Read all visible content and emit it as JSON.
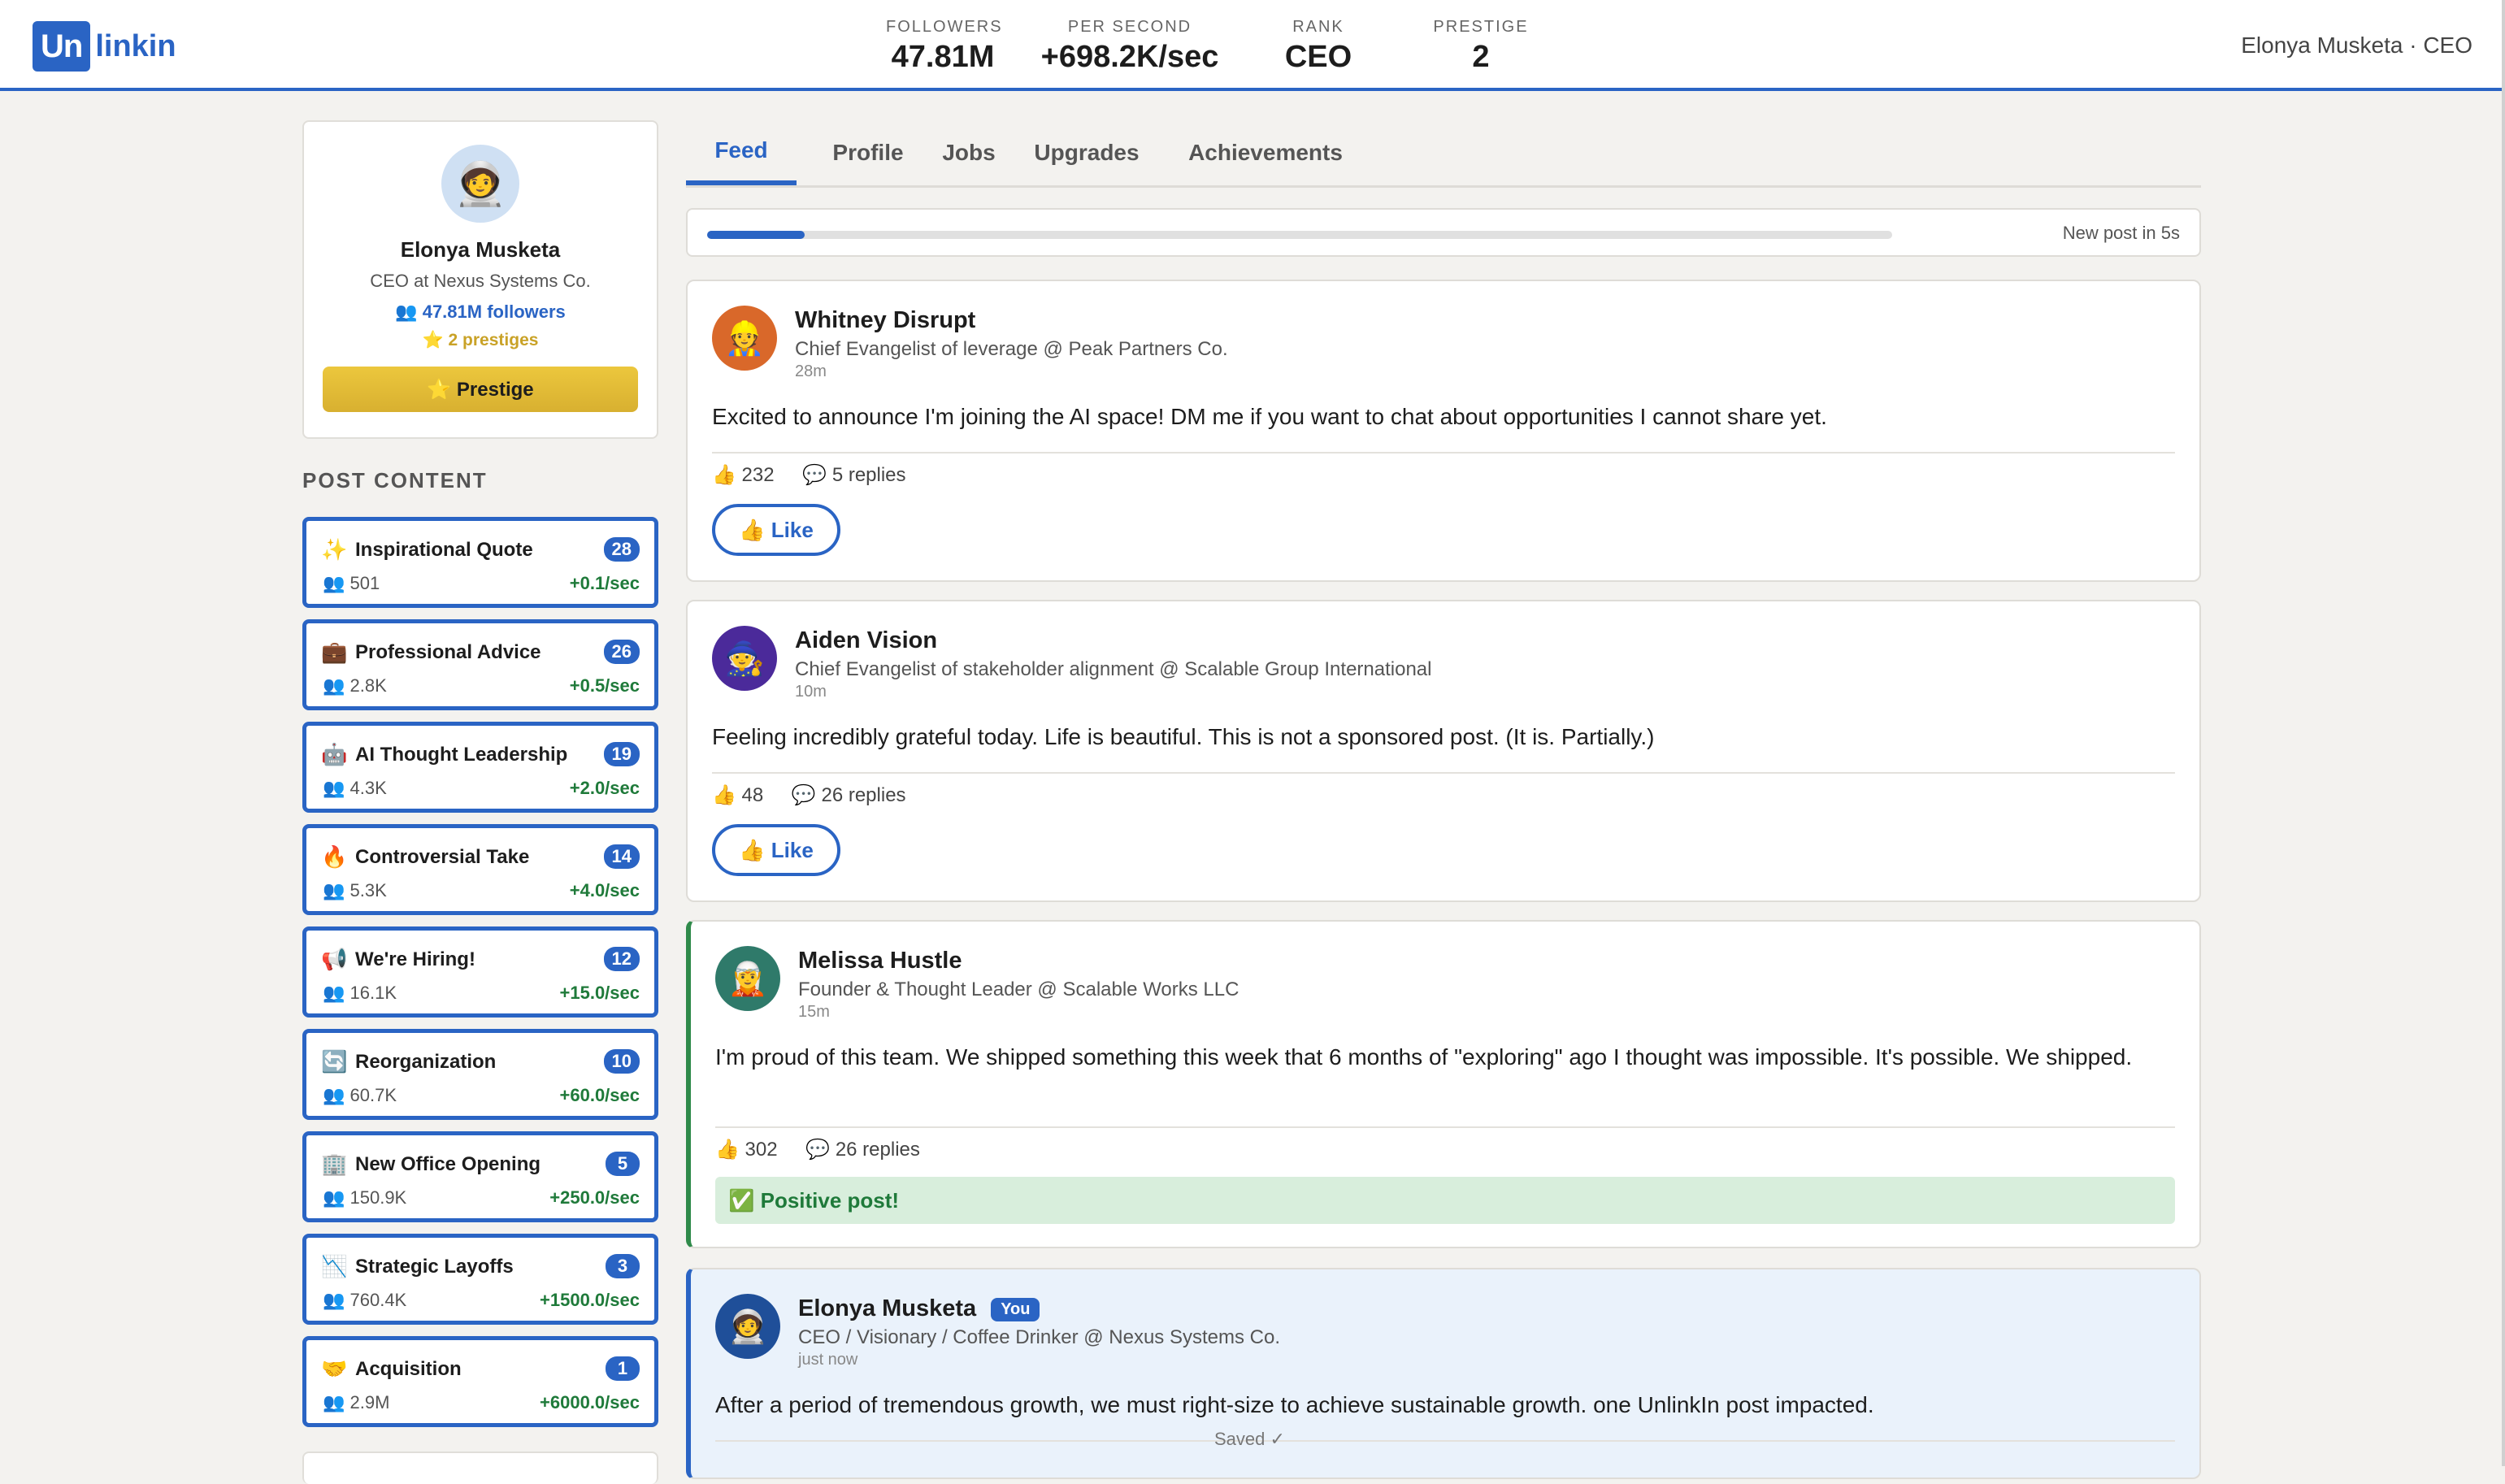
{
  "app": {
    "logo_mark": "Un",
    "logo_text": "linkin",
    "user_tag": "Elonya Musketa · CEO"
  },
  "stats": [
    {
      "label": "FOLLOWERS",
      "value": "47.81M"
    },
    {
      "label": "PER SECOND",
      "value": "+698.2K/sec"
    },
    {
      "label": "RANK",
      "value": "CEO"
    },
    {
      "label": "PRESTIGE",
      "value": "2"
    }
  ],
  "profile": {
    "avatar_emoji": "🧑‍🚀",
    "name": "Elonya Musketa",
    "title": "CEO at Nexus Systems Co.",
    "followers": "👥 47.81M followers",
    "prestiges": "⭐ 2 prestiges",
    "prestige_button": "⭐ Prestige"
  },
  "content_section_title": "POST CONTENT",
  "content_items": [
    {
      "icon": "✨",
      "name": "Inspirational Quote",
      "count": "28",
      "people": "👥 501",
      "rate": "+0.1/sec"
    },
    {
      "icon": "💼",
      "name": "Professional Advice",
      "count": "26",
      "people": "👥 2.8K",
      "rate": "+0.5/sec"
    },
    {
      "icon": "🤖",
      "name": "AI Thought Leadership",
      "count": "19",
      "people": "👥 4.3K",
      "rate": "+2.0/sec"
    },
    {
      "icon": "🔥",
      "name": "Controversial Take",
      "count": "14",
      "people": "👥 5.3K",
      "rate": "+4.0/sec"
    },
    {
      "icon": "📢",
      "name": "We're Hiring!",
      "count": "12",
      "people": "👥 16.1K",
      "rate": "+15.0/sec"
    },
    {
      "icon": "🔄",
      "name": "Reorganization",
      "count": "10",
      "people": "👥 60.7K",
      "rate": "+60.0/sec"
    },
    {
      "icon": "🏢",
      "name": "New Office Opening",
      "count": "5",
      "people": "👥 150.9K",
      "rate": "+250.0/sec"
    },
    {
      "icon": "📉",
      "name": "Strategic Layoffs",
      "count": "3",
      "people": "👥 760.4K",
      "rate": "+1500.0/sec"
    },
    {
      "icon": "🤝",
      "name": "Acquisition",
      "count": "1",
      "people": "👥 2.9M",
      "rate": "+6000.0/sec"
    }
  ],
  "tabs": [
    "Feed",
    "Profile",
    "Jobs",
    "Upgrades",
    "Achievements"
  ],
  "active_tab": "Feed",
  "progress": {
    "fraction": 0.082,
    "label": "New post in 5s"
  },
  "posts": [
    {
      "avatar_emoji": "👷",
      "avatar_color": "#d9682a",
      "author": "Whitney Disrupt",
      "headline": "Chief Evangelist of leverage @ Peak Partners Co.",
      "time": "28m",
      "body": "Excited to announce I'm joining the AI space! DM me if you want to chat about opportunities I cannot share yet.",
      "likes": "👍 232",
      "replies": "💬 5 replies",
      "like_button": "👍 Like"
    },
    {
      "avatar_emoji": "🧙",
      "avatar_color": "#4b2a9a",
      "author": "Aiden Vision",
      "headline": "Chief Evangelist of stakeholder alignment @ Scalable Group International",
      "time": "10m",
      "body": "Feeling incredibly grateful today. Life is beautiful. This is not a sponsored post. (It is. Partially.)",
      "likes": "👍 48",
      "replies": "💬 26 replies",
      "like_button": "👍 Like"
    },
    {
      "avatar_emoji": "🧝",
      "avatar_color": "#2f7a6a",
      "author": "Melissa Hustle",
      "headline": "Founder & Thought Leader @ Scalable Works LLC",
      "time": "15m",
      "body": "I'm proud of this team. We shipped something this week that 6 months of \"exploring\" ago I thought was impossible. It's possible. We shipped.",
      "likes": "👍 302",
      "replies": "💬 26 replies",
      "banner": "✅ Positive post!"
    },
    {
      "avatar_emoji": "🧑‍🚀",
      "avatar_color": "#1f4f99",
      "author": "Elonya Musketa",
      "you_badge": "You",
      "headline": "CEO / Visionary / Coffee Drinker @ Nexus Systems Co.",
      "time": "just now",
      "body": "After a period of tremendous growth, we must right-size to achieve sustainable growth. one UnlinkIn post impacted."
    }
  ],
  "saved_indicator": "Saved ✓"
}
